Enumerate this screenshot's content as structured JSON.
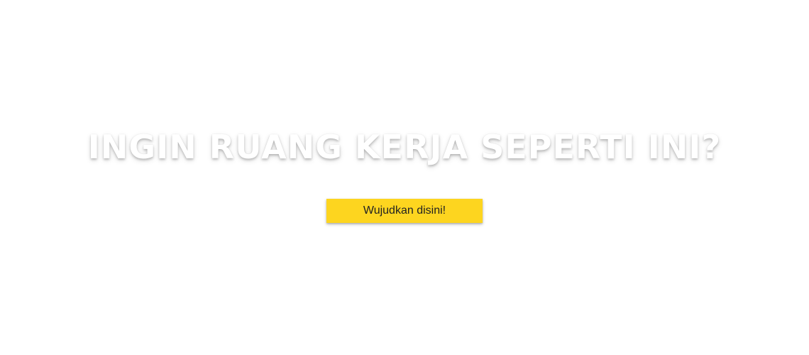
{
  "hero": {
    "title": "INGIN RUANG KERJA SEPERTI INI?",
    "cta_label": "Wujudkan disini!"
  },
  "colors": {
    "background": "#ffffff",
    "title_text": "#ffffff",
    "cta_background": "#fdd51f",
    "cta_text": "#222222"
  }
}
